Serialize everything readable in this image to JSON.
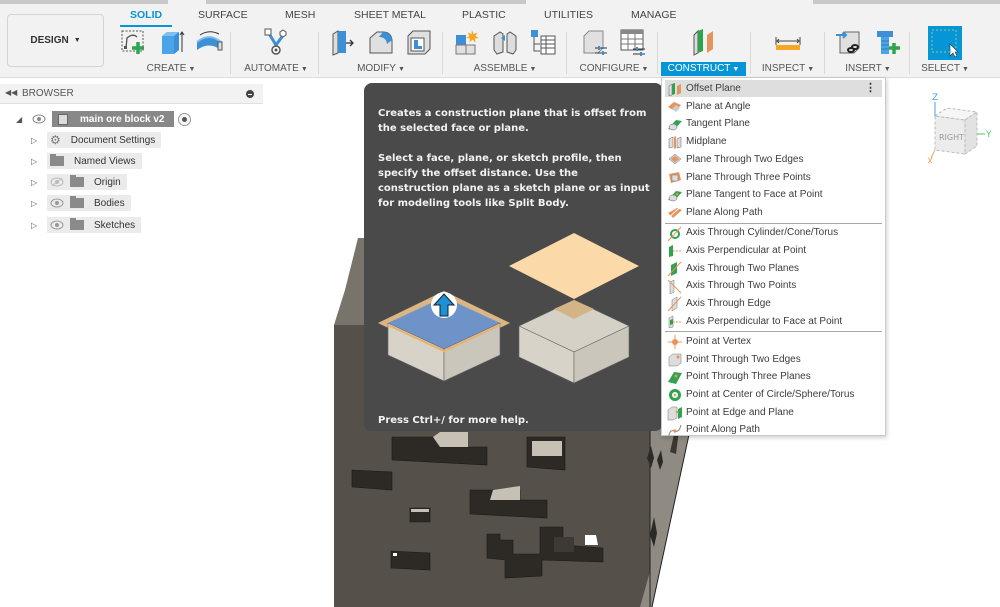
{
  "workspace": {
    "label": "DESIGN"
  },
  "tabs": [
    {
      "label": "SOLID",
      "active": true
    },
    {
      "label": "SURFACE"
    },
    {
      "label": "MESH"
    },
    {
      "label": "SHEET METAL"
    },
    {
      "label": "PLASTIC"
    },
    {
      "label": "UTILITIES"
    },
    {
      "label": "MANAGE"
    }
  ],
  "groups": [
    {
      "label": "CREATE",
      "icons": [
        "create-sketch-icon",
        "extrude-icon",
        "revolve-icon"
      ]
    },
    {
      "label": "AUTOMATE",
      "icons": [
        "automate-icon"
      ]
    },
    {
      "label": "MODIFY",
      "icons": [
        "press-pull-icon",
        "fillet-icon",
        "shell-icon"
      ]
    },
    {
      "label": "ASSEMBLE",
      "icons": [
        "new-component-icon",
        "joint-icon",
        "bom-table-icon"
      ]
    },
    {
      "label": "CONFIGURE",
      "icons": [
        "configure-model-icon",
        "configuration-table-icon"
      ]
    },
    {
      "label": "CONSTRUCT",
      "icons": [
        "offset-plane-icon"
      ],
      "active": true
    },
    {
      "label": "INSPECT",
      "icons": [
        "measure-icon"
      ]
    },
    {
      "label": "INSERT",
      "icons": [
        "insert-derive-icon",
        "insert-mcmaster-icon"
      ]
    },
    {
      "label": "SELECT",
      "icons": [
        "window-select-icon"
      ]
    }
  ],
  "browser": {
    "title": "BROWSER",
    "root": "main ore block v2",
    "items": [
      {
        "label": "Document Settings",
        "icon": "gear-icon",
        "eye": null
      },
      {
        "label": "Named Views",
        "icon": "folder-icon",
        "eye": null
      },
      {
        "label": "Origin",
        "icon": "folder-icon",
        "eye": "hidden"
      },
      {
        "label": "Bodies",
        "icon": "folder-icon",
        "eye": "visible"
      },
      {
        "label": "Sketches",
        "icon": "folder-icon",
        "eye": "visible"
      }
    ]
  },
  "viewcube": {
    "face": "RIGHT",
    "axes": {
      "z": "Z",
      "y": "Y",
      "x": "X"
    }
  },
  "tooltip": {
    "para1": "Creates a construction plane that is offset from the selected face or plane.",
    "para2": "Select a face, plane, or sketch profile, then specify the offset distance. Use the construction plane as a sketch plane or as input for modeling tools like Split Body.",
    "help": "Press Ctrl+/ for more help."
  },
  "construct_menu": {
    "planes": [
      {
        "label": "Offset Plane",
        "icon": "offset-plane-icon",
        "highlighted": true
      },
      {
        "label": "Plane at Angle",
        "icon": "plane-at-angle-icon"
      },
      {
        "label": "Tangent Plane",
        "icon": "tangent-plane-icon"
      },
      {
        "label": "Midplane",
        "icon": "midplane-icon"
      },
      {
        "label": "Plane Through Two Edges",
        "icon": "plane-two-edges-icon"
      },
      {
        "label": "Plane Through Three Points",
        "icon": "plane-three-points-icon"
      },
      {
        "label": "Plane Tangent to Face at Point",
        "icon": "plane-tangent-face-point-icon"
      },
      {
        "label": "Plane Along Path",
        "icon": "plane-along-path-icon"
      }
    ],
    "axes": [
      {
        "label": "Axis Through Cylinder/Cone/Torus",
        "icon": "axis-cylinder-icon"
      },
      {
        "label": "Axis Perpendicular at Point",
        "icon": "axis-perpendicular-point-icon"
      },
      {
        "label": "Axis Through Two Planes",
        "icon": "axis-two-planes-icon"
      },
      {
        "label": "Axis Through Two Points",
        "icon": "axis-two-points-icon"
      },
      {
        "label": "Axis Through Edge",
        "icon": "axis-edge-icon"
      },
      {
        "label": "Axis Perpendicular to Face at Point",
        "icon": "axis-perpendicular-face-icon"
      }
    ],
    "points": [
      {
        "label": "Point at Vertex",
        "icon": "point-vertex-icon"
      },
      {
        "label": "Point Through Two Edges",
        "icon": "point-two-edges-icon"
      },
      {
        "label": "Point Through Three Planes",
        "icon": "point-three-planes-icon"
      },
      {
        "label": "Point at Center of Circle/Sphere/Torus",
        "icon": "point-center-icon"
      },
      {
        "label": "Point at Edge and Plane",
        "icon": "point-edge-plane-icon"
      },
      {
        "label": "Point Along Path",
        "icon": "point-along-path-icon"
      }
    ]
  }
}
